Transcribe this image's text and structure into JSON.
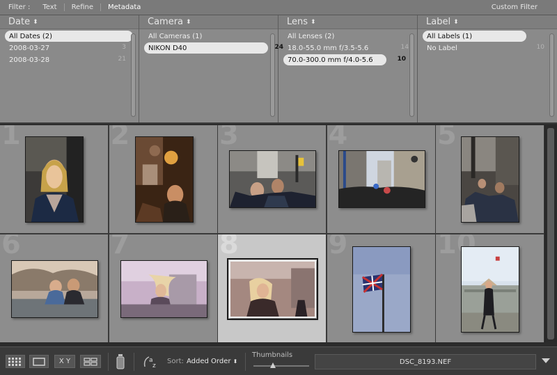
{
  "filterbar": {
    "label": "Filter :",
    "items": [
      "Text",
      "Refine",
      "Metadata"
    ],
    "active_index": 2,
    "custom_filter": "Custom Filter"
  },
  "columns": [
    {
      "title": "Date",
      "rows": [
        {
          "label": "All Dates (2)",
          "count": "",
          "selected": true
        },
        {
          "label": "2008-03-27",
          "count": "3",
          "selected": false
        },
        {
          "label": "2008-03-28",
          "count": "21",
          "selected": false
        }
      ]
    },
    {
      "title": "Camera",
      "rows": [
        {
          "label": "All Cameras (1)",
          "count": "",
          "selected": false
        },
        {
          "label": "NIKON D40",
          "count": "24",
          "selected": true
        }
      ]
    },
    {
      "title": "Lens",
      "rows": [
        {
          "label": "All Lenses (2)",
          "count": "",
          "selected": false
        },
        {
          "label": "18.0-55.0 mm f/3.5-5.6",
          "count": "14",
          "selected": false
        },
        {
          "label": "70.0-300.0 mm f/4.0-5.6",
          "count": "10",
          "selected": true
        }
      ]
    },
    {
      "title": "Label",
      "rows": [
        {
          "label": "All Labels (1)",
          "count": "",
          "selected": true
        },
        {
          "label": "No Label",
          "count": "10",
          "selected": false
        }
      ]
    }
  ],
  "grid": {
    "cells": [
      {
        "number": "1",
        "subject": "woman-portrait-photo",
        "selected": false
      },
      {
        "number": "2",
        "subject": "market-stall-photo",
        "selected": false
      },
      {
        "number": "3",
        "subject": "street-crowd-photo",
        "selected": false
      },
      {
        "number": "4",
        "subject": "city-street-photo",
        "selected": false
      },
      {
        "number": "5",
        "subject": "crowd-walking-photo",
        "selected": false
      },
      {
        "number": "6",
        "subject": "children-on-wall-photo",
        "selected": false
      },
      {
        "number": "7",
        "subject": "windswept-girl-photo",
        "selected": false
      },
      {
        "number": "8",
        "subject": "woman-in-sunlight-photo",
        "selected": true
      },
      {
        "number": "9",
        "subject": "flag-on-pole-photo",
        "selected": false
      },
      {
        "number": "10",
        "subject": "girl-at-palace-photo",
        "selected": false
      }
    ]
  },
  "toolbar": {
    "sort_label": "Sort:",
    "sort_value": "Added Order",
    "thumbnails_label": "Thumbnails",
    "thumbnail_size_fraction": 0.35,
    "filename": "DSC_8193.NEF",
    "compare_label": "X Y"
  }
}
